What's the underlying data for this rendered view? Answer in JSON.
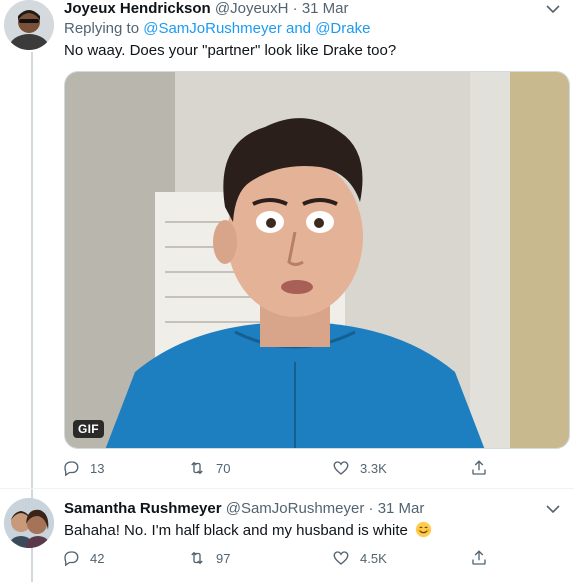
{
  "tweet1": {
    "author_name": "Joyeux Hendrickson",
    "handle": "@JoyeuxH",
    "separator": "·",
    "date": "31 Mar",
    "replying_prefix": "Replying to",
    "replying_user1": "@SamJoRushmeyer",
    "replying_and": "and",
    "replying_user2": "@Drake",
    "text": "No waay. Does your \"partner\" look like Drake too?",
    "media_badge": "GIF",
    "replies": "13",
    "retweets": "70",
    "likes": "3.3K"
  },
  "tweet2": {
    "author_name": "Samantha Rushmeyer",
    "handle": "@SamJoRushmeyer",
    "separator": "·",
    "date": "31 Mar",
    "text": "Bahaha! No. I'm half black and my husband is white",
    "emoji": "smiling-face-with-smiling-eyes",
    "replies": "42",
    "retweets": "97",
    "likes": "4.5K"
  },
  "colors": {
    "accent": "#1d9bf0",
    "muted": "#536471",
    "text": "#0f1419",
    "thread_line": "#cfd9de"
  }
}
